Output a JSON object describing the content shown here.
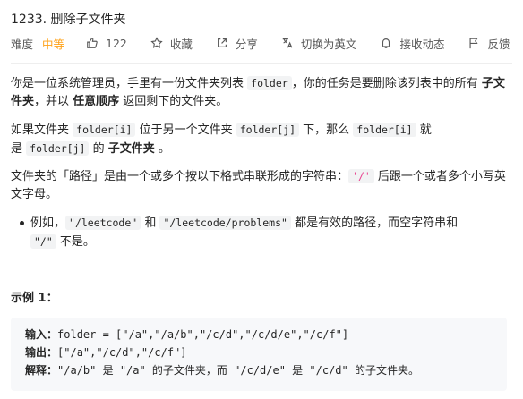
{
  "problem": {
    "title": "1233. 删除子文件夹",
    "difficulty_label": "难度",
    "difficulty_value": "中等",
    "likes": "122",
    "favorite": "收藏",
    "share": "分享",
    "switch_lang": "切换为英文",
    "notify": "接收动态",
    "feedback": "反馈"
  },
  "desc": {
    "p1_a": "你是一位系统管理员，手里有一份文件夹列表 ",
    "p1_code": "folder",
    "p1_b": "，你的任务是要删除该列表中的所有 ",
    "p1_bold1": "子文件夹",
    "p1_c": "，并以 ",
    "p1_bold2": "任意顺序",
    "p1_d": " 返回剩下的文件夹。",
    "p2_a": "如果文件夹 ",
    "p2_code1": "folder[i]",
    "p2_b": " 位于另一个文件夹 ",
    "p2_code2": "folder[j]",
    "p2_c": " 下，那么 ",
    "p2_code3": "folder[i]",
    "p2_d": " 就是 ",
    "p2_code4": "folder[j]",
    "p2_e": " 的 ",
    "p2_bold": "子文件夹",
    "p2_f": " 。",
    "p3_a": "文件夹的「路径」是由一个或多个按以下格式串联形成的字符串：",
    "p3_code": "'/'",
    "p3_b": " 后跟一个或者多个小写英文字母。",
    "p4_a": "例如，",
    "p4_code1": "\"/leetcode\"",
    "p4_b": " 和 ",
    "p4_code2": "\"/leetcode/problems\"",
    "p4_c": " 都是有效的路径，而空字符串和 ",
    "p4_code3": "\"/\"",
    "p4_d": " 不是。"
  },
  "example": {
    "title": "示例 1：",
    "input_label": "输入：",
    "input_value": "folder = [\"/a\",\"/a/b\",\"/c/d\",\"/c/d/e\",\"/c/f\"]",
    "output_label": "输出：",
    "output_value": "[\"/a\",\"/c/d\",\"/c/f\"]",
    "explain_label": "解释：",
    "explain_value": "\"/a/b\" 是 \"/a\" 的子文件夹，而 \"/c/d/e\" 是 \"/c/d\" 的子文件夹。"
  }
}
